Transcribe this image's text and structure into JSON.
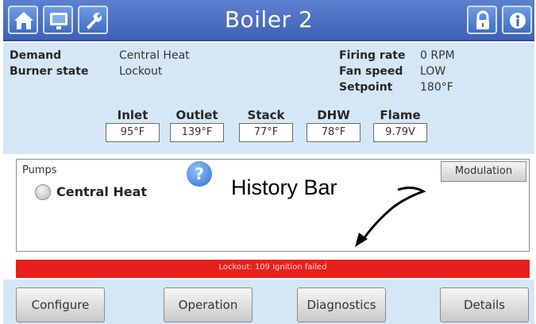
{
  "header": {
    "title": "Boiler 2",
    "icons": [
      "home-icon",
      "monitor-icon",
      "wrench-icon",
      "lock-icon",
      "info-icon"
    ]
  },
  "status": {
    "demand_label": "Demand",
    "demand_value": "Central Heat",
    "burner_label": "Burner state",
    "burner_value": "Lockout",
    "firing_label": "Firing rate",
    "firing_value": "0 RPM",
    "fan_label": "Fan speed",
    "fan_value": "LOW",
    "setpoint_label": "Setpoint",
    "setpoint_value": "180°F"
  },
  "sensors": [
    {
      "label": "Inlet",
      "value": "95°F"
    },
    {
      "label": "Outlet",
      "value": "139°F"
    },
    {
      "label": "Stack",
      "value": "77°F"
    },
    {
      "label": "DHW",
      "value": "78°F"
    },
    {
      "label": "Flame",
      "value": "9.79V"
    }
  ],
  "pumps": {
    "label": "Pumps",
    "radio_label": "Central Heat"
  },
  "help_glyph": "?",
  "modulation_label": "Modulation",
  "callout": "History Bar",
  "history_text": "Lockout: 109  Ignition failed",
  "nav": {
    "configure": "Configure",
    "operation": "Operation",
    "diagnostics": "Diagnostics",
    "details": "Details"
  },
  "colors": {
    "title_bar": "#4a6cc0",
    "panel": "#d5e7f7",
    "history_bar": "#e7201d"
  }
}
